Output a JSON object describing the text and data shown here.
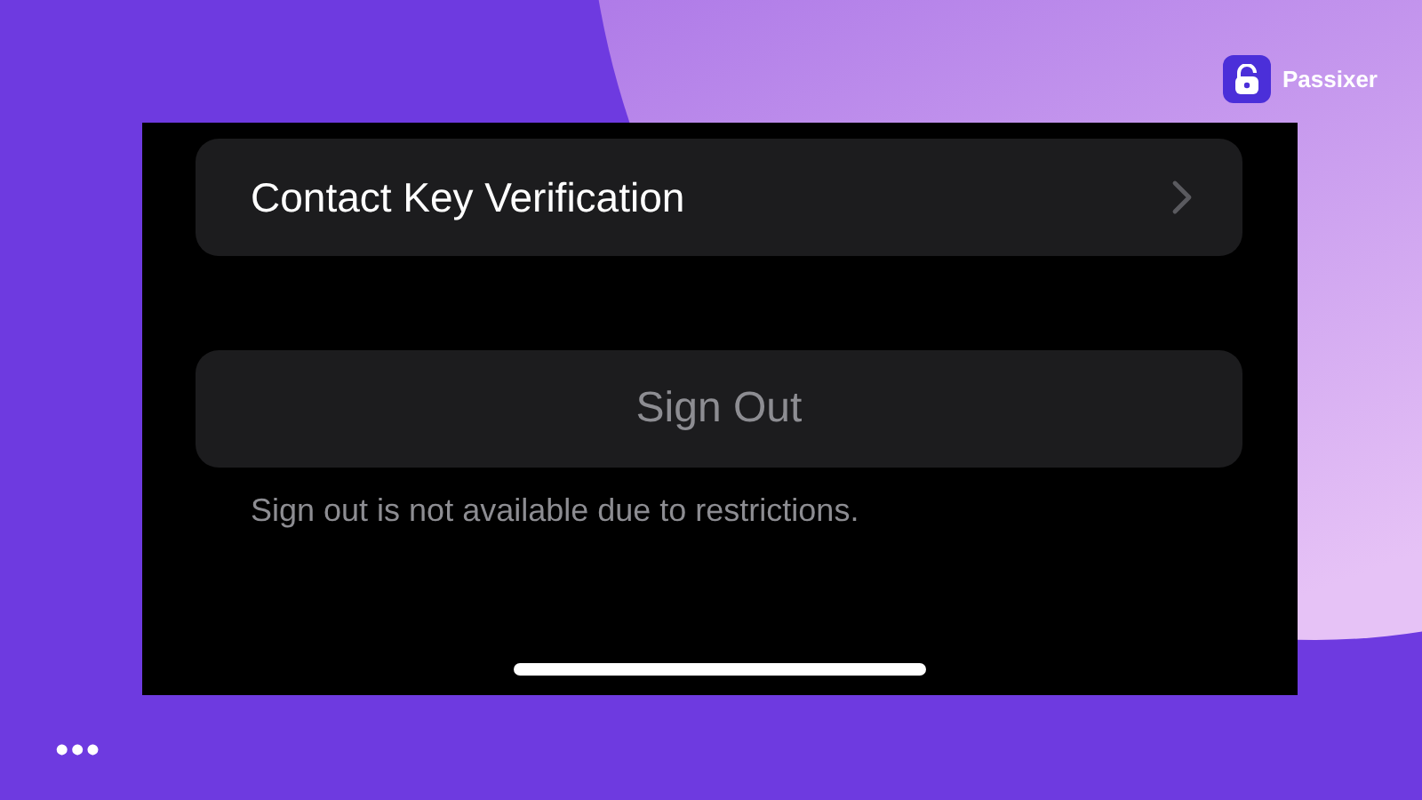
{
  "brand": {
    "name": "Passixer"
  },
  "settings": {
    "rows": [
      {
        "label": "Contact Key Verification"
      }
    ],
    "sign_out": {
      "label": "Sign Out",
      "disabled": true
    },
    "note": "Sign out is not available due to restrictions."
  },
  "footer": {
    "menu": "•••"
  }
}
